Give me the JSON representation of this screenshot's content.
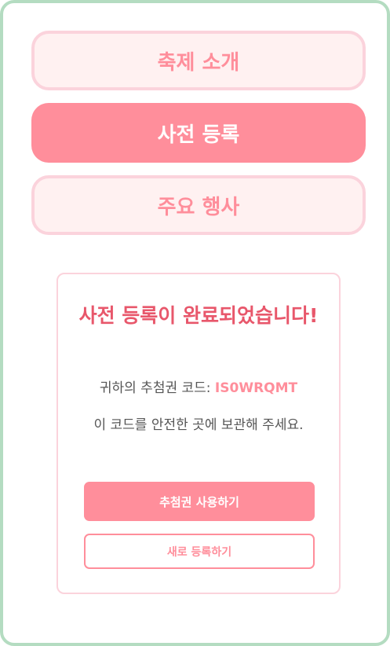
{
  "nav": {
    "items": [
      {
        "label": "축제 소개"
      },
      {
        "label": "사전 등록"
      },
      {
        "label": "주요 행사"
      }
    ]
  },
  "result": {
    "title": "사전 등록이 완료되었습니다!",
    "code_prefix": "귀하의 추첨권 코드: ",
    "code_value": "IS0WRQMT",
    "note": "이 코드를 안전한 곳에 보관해 주세요.",
    "primary_button": "추첨권 사용하기",
    "secondary_button": "새로 등록하기"
  },
  "colors": {
    "accent": "#ff8e9b",
    "title": "#e8576b",
    "border_pink": "#fbd3dc",
    "frame_green": "#b4dcc1"
  }
}
